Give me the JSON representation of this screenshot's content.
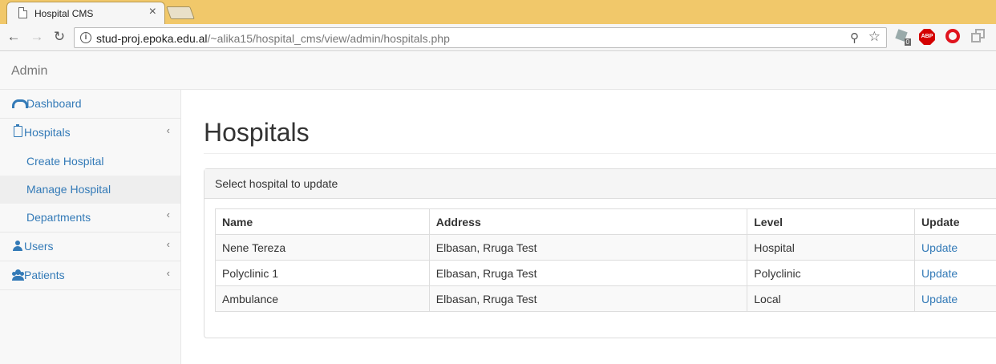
{
  "browser": {
    "tab_title": "Hospital CMS",
    "url_host": "stud-proj.epoka.edu.al",
    "url_path": "/~alika15/hospital_cms/view/admin/hospitals.php",
    "extension_badge": "0",
    "abp_label": "ABP"
  },
  "navbar": {
    "brand": "Admin"
  },
  "sidebar": {
    "items": [
      {
        "label": "Dashboard",
        "icon": "dashboard-icon"
      },
      {
        "label": "Hospitals",
        "icon": "clipboard-icon",
        "children": [
          "Create Hospital",
          "Manage Hospital",
          "Departments"
        ],
        "active_child": "Manage Hospital"
      },
      {
        "label": "Users",
        "icon": "user-icon"
      },
      {
        "label": "Patients",
        "icon": "users-icon"
      }
    ]
  },
  "main": {
    "title": "Hospitals",
    "panel_heading": "Select hospital to update",
    "table": {
      "headers": [
        "Name",
        "Address",
        "Level",
        "Update"
      ],
      "rows": [
        {
          "name": "Nene Tereza",
          "address": "Elbasan, Rruga Test",
          "level": "Hospital",
          "action": "Update"
        },
        {
          "name": "Polyclinic 1",
          "address": "Elbasan, Rruga Test",
          "level": "Polyclinic",
          "action": "Update"
        },
        {
          "name": "Ambulance",
          "address": "Elbasan, Rruga Test",
          "level": "Local",
          "action": "Update"
        }
      ]
    }
  },
  "colors": {
    "link": "#337ab7",
    "tabstrip": "#f1c86a"
  }
}
